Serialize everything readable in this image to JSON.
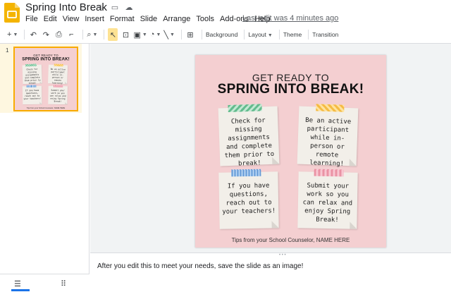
{
  "header": {
    "title": "Spring Into Break",
    "icons": [
      "star-icon",
      "folder-icon",
      "cloud-icon"
    ],
    "last_edit": "Last edit was 4 minutes ago"
  },
  "menu": [
    "File",
    "Edit",
    "View",
    "Insert",
    "Format",
    "Slide",
    "Arrange",
    "Tools",
    "Add-ons",
    "Help"
  ],
  "toolbar": {
    "background": "Background",
    "layout": "Layout",
    "theme": "Theme",
    "transition": "Transition"
  },
  "filmstrip": {
    "slide_number": "1"
  },
  "slide": {
    "kicker": "GET READY TO",
    "title": "SPRING INTO BREAK!",
    "notes": [
      "Check for missing assignments and complete them prior to break!",
      "Be an active participant while in-person or remote learning!",
      "If you have questions, reach out to your teachers!",
      "Submit your work so you can relax and enjoy Spring Break!"
    ],
    "footer": "Tips from your School Counselor, NAME HERE"
  },
  "speaker_notes": "After you edit this to meet your needs, save the slide as an image!",
  "colors": {
    "slide_bg": "#f4cfd1",
    "selection": "#f9ab00",
    "accent": "#1a73e8"
  }
}
